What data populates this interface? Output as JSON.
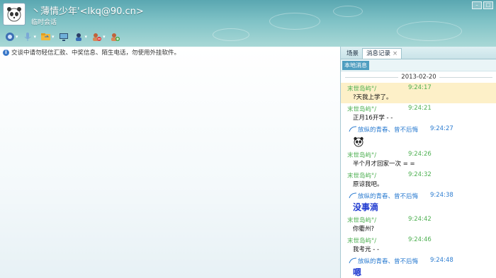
{
  "header": {
    "title": "丶薄情少年'<lkq@90.cn>",
    "subtitle": "临时会话"
  },
  "window_controls": {
    "minimize": "–",
    "maximize": "□"
  },
  "notice": "交谈中请勿轻信汇款、中奖信息、陌生电话，勿使用外挂软件。",
  "tabs": [
    {
      "label": "场景"
    },
    {
      "label": "消息记录",
      "close": "×"
    }
  ],
  "subtab": "本地消息",
  "date": "2013-02-20",
  "messages": [
    {
      "kind": "incoming",
      "sender": "末世岛屿°/",
      "time": "9:24:17",
      "text": "?天我上学了。",
      "highlight": true
    },
    {
      "kind": "incoming",
      "sender": "末世岛屿°/",
      "time": "9:24:21",
      "text": "正月16开学 - -"
    },
    {
      "kind": "outgoing",
      "sender": "放纵的青春、曾不后悔",
      "time": "9:24:27",
      "emoticon": "panda-face-icon"
    },
    {
      "kind": "incoming",
      "sender": "末世岛屿°/",
      "time": "9:24:26",
      "text": "半个月才回家一次  = ="
    },
    {
      "kind": "incoming",
      "sender": "末世岛屿°/",
      "time": "9:24:32",
      "text": "原谅我吧。"
    },
    {
      "kind": "outgoing",
      "sender": "放纵的青春、曾不后悔",
      "time": "9:24:38",
      "text": "没事滴",
      "big": true
    },
    {
      "kind": "incoming",
      "sender": "末世岛屿°/",
      "time": "9:24:42",
      "text": "你衢州?"
    },
    {
      "kind": "incoming",
      "sender": "末世岛屿°/",
      "time": "9:24:46",
      "text": "我考光 - -"
    },
    {
      "kind": "outgoing",
      "sender": "放纵的青春、曾不后悔",
      "time": "9:24:48",
      "text": "嗯",
      "big": true
    }
  ]
}
